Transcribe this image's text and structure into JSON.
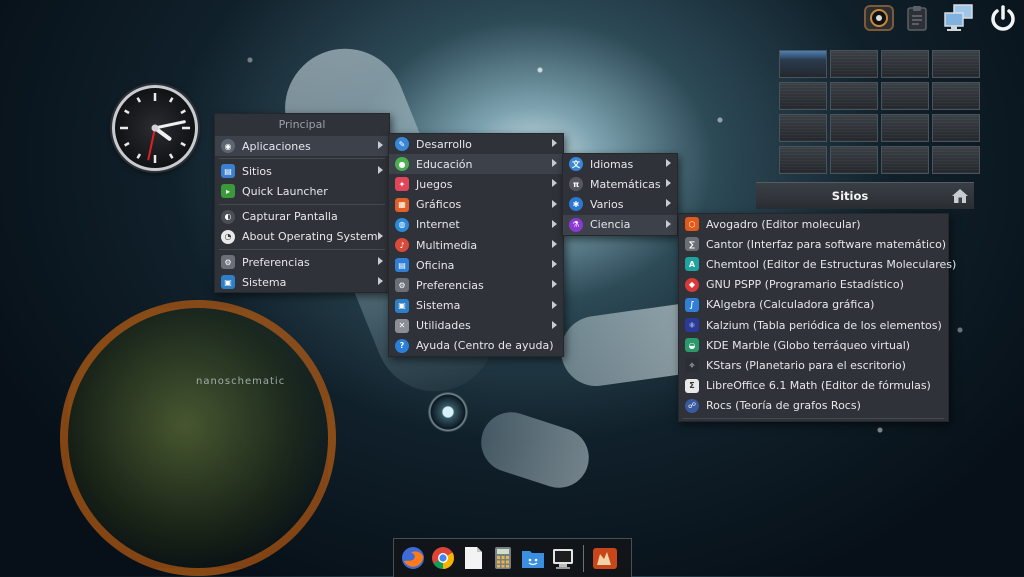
{
  "desktop": {
    "wallpaper_text": "nanoschematic"
  },
  "clock": {
    "hours": 4,
    "minutes": 13,
    "seconds": 32
  },
  "tray": {
    "icons": [
      "gauge-icon",
      "clipboard-icon",
      "network-icon",
      "power-icon"
    ]
  },
  "pager": {
    "rows": 4,
    "columns": 4,
    "active_index": 0
  },
  "sites_panel": {
    "title": "Sitios"
  },
  "main_menu": {
    "title": "Principal",
    "items": [
      {
        "label": "Aplicaciones",
        "icon": "applications-icon",
        "submenu": true
      },
      {
        "label": "Sitios",
        "icon": "places-icon",
        "submenu": true
      },
      {
        "label": "Quick Launcher",
        "icon": "quick-launcher-icon",
        "submenu": false
      },
      {
        "label": "Capturar Pantalla",
        "icon": "screenshot-icon",
        "submenu": false
      },
      {
        "label": "About Operating System",
        "icon": "about-os-icon",
        "submenu": true
      },
      {
        "label": "Preferencias",
        "icon": "preferences-icon",
        "submenu": true
      },
      {
        "label": "Sistema",
        "icon": "system-icon",
        "submenu": true
      }
    ]
  },
  "apps_menu": {
    "items": [
      {
        "label": "Desarrollo",
        "icon": "development-icon",
        "submenu": true
      },
      {
        "label": "Educación",
        "icon": "education-icon",
        "submenu": true
      },
      {
        "label": "Juegos",
        "icon": "games-icon",
        "submenu": true
      },
      {
        "label": "Gráficos",
        "icon": "graphics-icon",
        "submenu": true
      },
      {
        "label": "Internet",
        "icon": "internet-icon",
        "submenu": true
      },
      {
        "label": "Multimedia",
        "icon": "multimedia-icon",
        "submenu": true
      },
      {
        "label": "Oficina",
        "icon": "office-icon",
        "submenu": true
      },
      {
        "label": "Preferencias",
        "icon": "preferences-icon",
        "submenu": true
      },
      {
        "label": "Sistema",
        "icon": "system-icon",
        "submenu": true
      },
      {
        "label": "Utilidades",
        "icon": "utilities-icon",
        "submenu": true
      },
      {
        "label": "Ayuda (Centro de ayuda)",
        "icon": "help-icon",
        "submenu": false
      }
    ]
  },
  "education_menu": {
    "items": [
      {
        "label": "Idiomas",
        "icon": "languages-icon",
        "submenu": true
      },
      {
        "label": "Matemáticas",
        "icon": "math-icon",
        "submenu": true
      },
      {
        "label": "Varios",
        "icon": "misc-icon",
        "submenu": true
      },
      {
        "label": "Ciencia",
        "icon": "science-icon",
        "submenu": true
      }
    ]
  },
  "science_menu": {
    "items": [
      {
        "label": "Avogadro (Editor molecular)",
        "icon": "avogadro-icon"
      },
      {
        "label": "Cantor (Interfaz para software matemático)",
        "icon": "cantor-icon"
      },
      {
        "label": "Chemtool (Editor de Estructuras Moleculares)",
        "icon": "chemtool-icon"
      },
      {
        "label": "GNU PSPP (Programario Estadístico)",
        "icon": "pspp-icon"
      },
      {
        "label": "KAlgebra (Calculadora gráfica)",
        "icon": "kalgebra-icon"
      },
      {
        "label": "Kalzium (Tabla periódica de los elementos)",
        "icon": "kalzium-icon"
      },
      {
        "label": "KDE Marble (Globo terráqueo virtual)",
        "icon": "marble-icon"
      },
      {
        "label": "KStars (Planetario para el escritorio)",
        "icon": "kstars-icon"
      },
      {
        "label": "LibreOffice 6.1 Math (Editor de fórmulas)",
        "icon": "libreoffice-math-icon"
      },
      {
        "label": "Rocs (Teoría de grafos Rocs)",
        "icon": "rocs-icon"
      }
    ]
  },
  "dock": {
    "items": [
      "firefox-icon",
      "chrome-icon",
      "text-editor-icon",
      "calculator-icon",
      "file-manager-icon",
      "terminal-icon",
      "user-app-icon"
    ]
  },
  "colors": {
    "menu_bg": "#2f3238",
    "menu_highlight": "#3d414a",
    "clock_second_hand": "#e02020"
  }
}
